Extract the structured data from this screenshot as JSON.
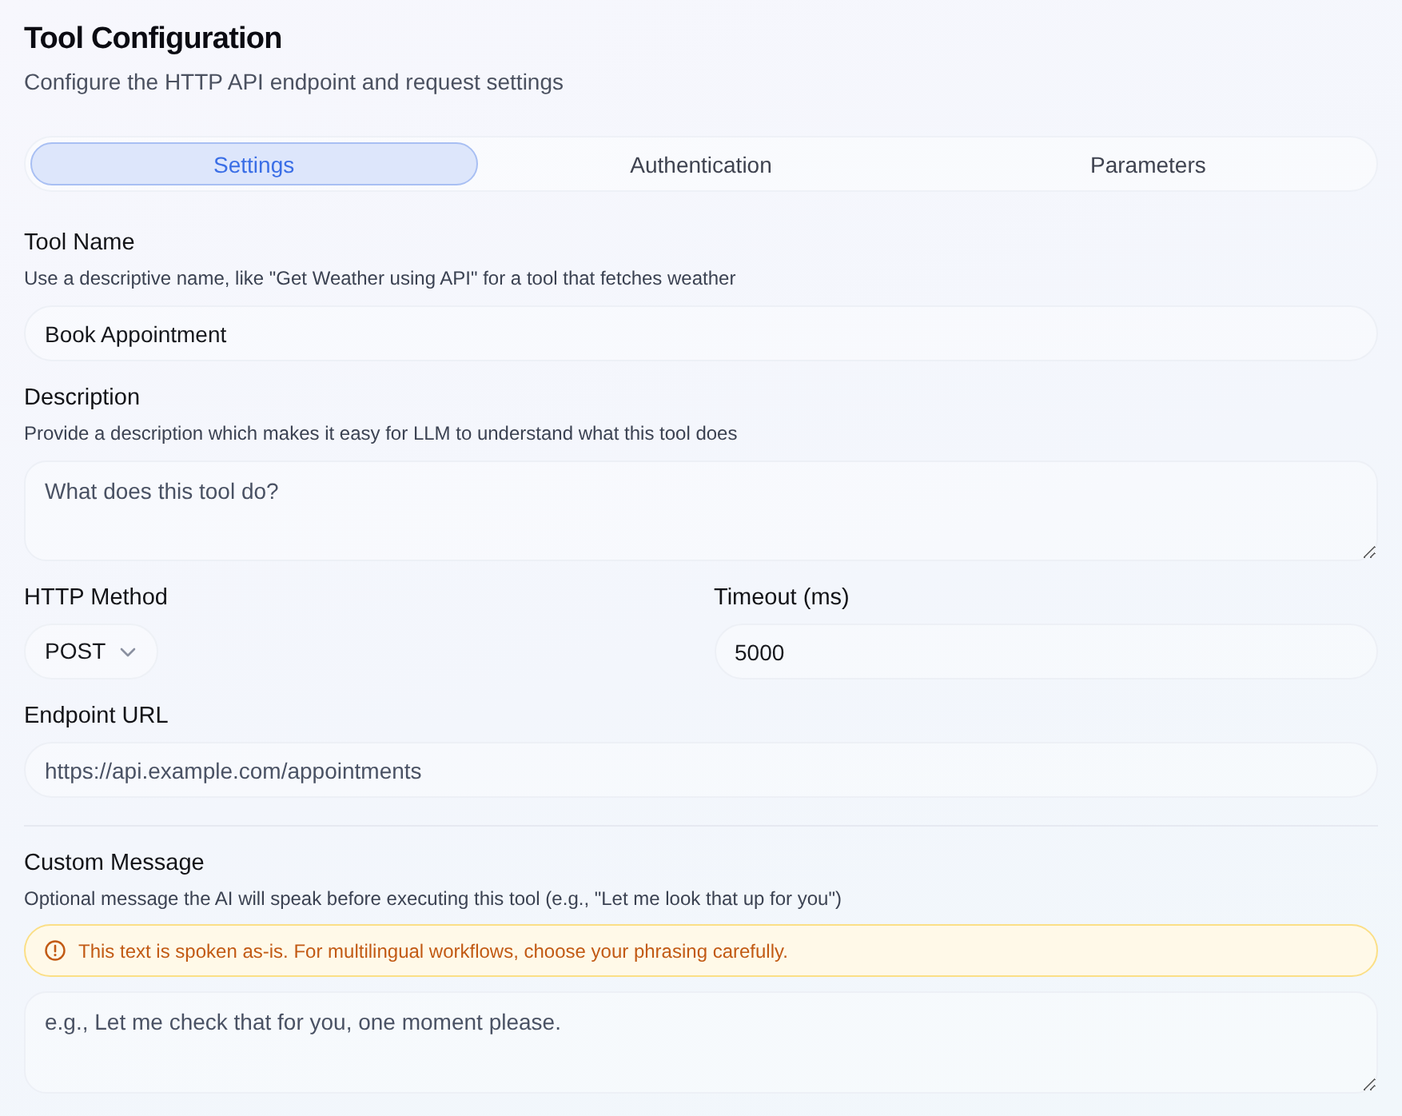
{
  "header": {
    "title": "Tool Configuration",
    "subtitle": "Configure the HTTP API endpoint and request settings"
  },
  "tabs": [
    {
      "label": "Settings",
      "selected": true
    },
    {
      "label": "Authentication",
      "selected": false
    },
    {
      "label": "Parameters",
      "selected": false
    }
  ],
  "fields": [
    {
      "kind": "input",
      "label": "Tool Name",
      "hint": "Use a descriptive name, like \"Get Weather using API\" for a tool that fetches weather",
      "value": "Book Appointment"
    },
    {
      "kind": "textarea",
      "label": "Description",
      "hint": "Provide a description which makes it easy for LLM to understand what this tool does",
      "placeholder": "What does this tool do?"
    },
    {
      "kind": "row",
      "fields": [
        {
          "kind": "select",
          "label": "HTTP Method",
          "value": "POST"
        },
        {
          "kind": "input",
          "label": "Timeout (ms)",
          "value": "5000"
        }
      ]
    },
    {
      "kind": "input",
      "label": "Endpoint URL",
      "placeholder": "https://api.example.com/appointments"
    }
  ],
  "custom_message": {
    "label": "Custom Message",
    "hint": "Optional message the AI will speak before executing this tool (e.g., \"Let me look that up for you\")",
    "warning": "This text is spoken as-is. For multilingual workflows, choose your phrasing carefully.",
    "placeholder": "e.g., Let me check that for you, one moment please."
  }
}
